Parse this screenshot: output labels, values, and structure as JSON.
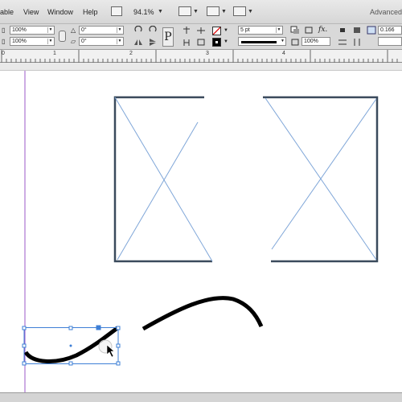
{
  "menu": {
    "items": [
      "able",
      "View",
      "Window",
      "Help"
    ],
    "zoom": "94.1%",
    "workspace": "Advanced"
  },
  "control_panel": {
    "scale_x": "100%",
    "scale_y": "100%",
    "rotate_angle": "0°",
    "shear_angle": "0°",
    "stroke_weight": "5 pt",
    "opacity": "100%",
    "ref_value": "0.166"
  },
  "ruler": {
    "ticks": [
      "0",
      "1",
      "2",
      "3",
      "4"
    ]
  },
  "canvas": {
    "stroke_color": "#000000",
    "frame_color": "#3a4a5c",
    "guide_color": "#7fa6d8",
    "margin_color": "#9b59c8",
    "selection_color": "#3e7fd6"
  },
  "icons": [
    "bridge-icon",
    "screen-mode-icon",
    "view-options-icon",
    "arrange-icon",
    "rotate-icon",
    "flip-icon",
    "text-p-icon",
    "align-icon",
    "fill-none-icon",
    "stroke-swatch-icon",
    "fx-icon",
    "drop-shadow-icon",
    "fit-frame-icon"
  ]
}
